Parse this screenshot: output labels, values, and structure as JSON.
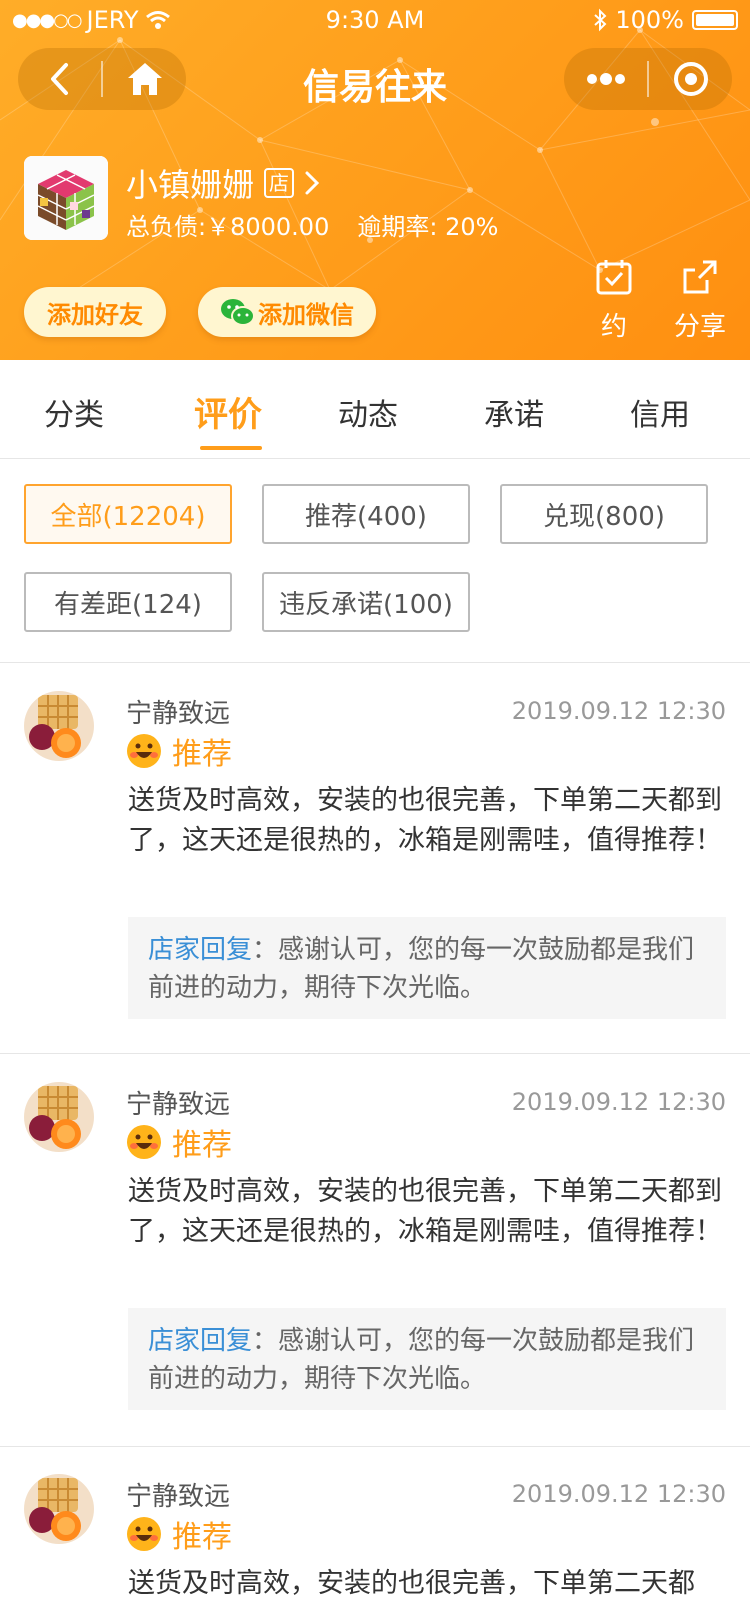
{
  "status_bar": {
    "signal_dots": "●●●○○",
    "carrier": "JERY",
    "time": "9:30 AM",
    "battery": "100%"
  },
  "nav": {
    "title": "信易往来",
    "icons": [
      "back-icon",
      "home-icon",
      "more-icon",
      "target-icon"
    ]
  },
  "shop": {
    "name": "小镇姗姗",
    "tag": "店",
    "debt_label": "总负债:",
    "debt_value": "￥8000.00",
    "overdue_label": "逾期率:",
    "overdue_value": "20%",
    "add_friend": "添加好友",
    "add_wechat": "添加微信",
    "appointment": "约",
    "share": "分享"
  },
  "tabs": [
    {
      "label": "分类"
    },
    {
      "label": "评价",
      "active": true
    },
    {
      "label": "动态"
    },
    {
      "label": "承诺"
    },
    {
      "label": "信用"
    }
  ],
  "filters": [
    {
      "label": "全部(12204)",
      "active": true
    },
    {
      "label": "推荐(400)"
    },
    {
      "label": "兑现(800)"
    },
    {
      "label": "有差距(124)"
    },
    {
      "label": "违反承诺(100)"
    }
  ],
  "reviews": [
    {
      "user": "宁静致远",
      "time": "2019.09.12 12:30",
      "tag": "推荐",
      "text": "送货及时高效，安装的也很完善，下单第二天都到了，这天还是很热的，冰箱是刚需哇，值得推荐！",
      "reply_label": "店家回复",
      "reply_text": "：感谢认可，您的每一次鼓励都是我们前进的动力，期待下次光临。"
    },
    {
      "user": "宁静致远",
      "time": "2019.09.12 12:30",
      "tag": "推荐",
      "text": "送货及时高效，安装的也很完善，下单第二天都到了，这天还是很热的，冰箱是刚需哇，值得推荐！",
      "reply_label": "店家回复",
      "reply_text": "：感谢认可，您的每一次鼓励都是我们前进的动力，期待下次光临。"
    },
    {
      "user": "宁静致远",
      "time": "2019.09.12 12:30",
      "tag": "推荐",
      "text": "送货及时高效，安装的也很完善，下单第二天都",
      "reply_label": "",
      "reply_text": ""
    }
  ],
  "colors": {
    "header_orange": "#ff9d1a",
    "accent": "#ff9d1a",
    "reply_blue": "#3a8fd6",
    "pill_bg": "#fff6d0"
  }
}
